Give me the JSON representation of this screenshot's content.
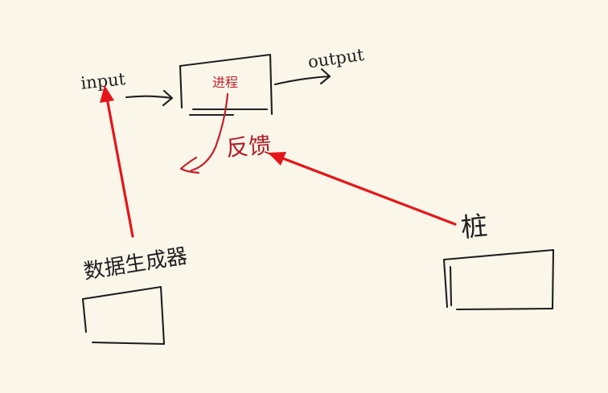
{
  "labels": {
    "input": "input",
    "process": "进程",
    "output": "output",
    "feedback": "反馈",
    "data_generator": "数据生成器",
    "stub": "桩"
  },
  "colors": {
    "background": "#fbf6ea",
    "ink": "#1f1f1f",
    "annotation_red": "#c4202a",
    "arrow_red": "#e5161a"
  }
}
